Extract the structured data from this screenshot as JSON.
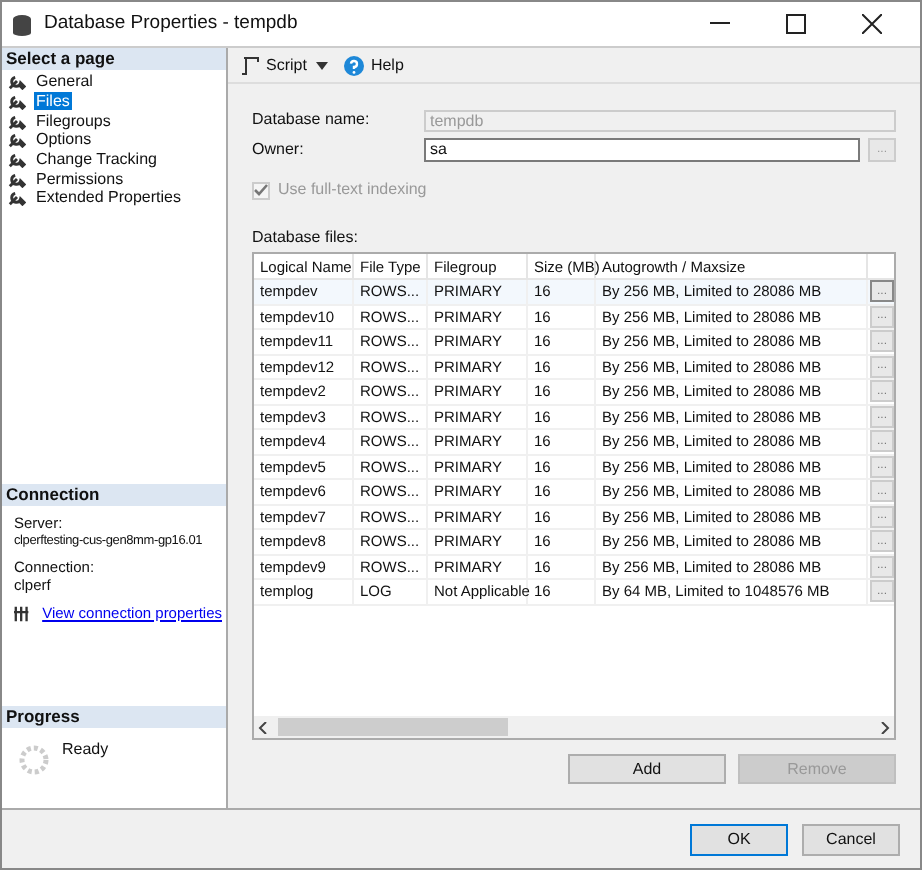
{
  "window": {
    "title": "Database Properties - tempdb"
  },
  "sidebar": {
    "header": "Select a page",
    "pages": [
      {
        "label": "General",
        "selected": false
      },
      {
        "label": "Files",
        "selected": true
      },
      {
        "label": "Filegroups",
        "selected": false
      },
      {
        "label": "Options",
        "selected": false
      },
      {
        "label": "Change Tracking",
        "selected": false
      },
      {
        "label": "Permissions",
        "selected": false
      },
      {
        "label": "Extended Properties",
        "selected": false
      }
    ]
  },
  "connection": {
    "header": "Connection",
    "server_label": "Server:",
    "server": "clperftesting-cus-gen8mm-gp16.01",
    "connection_label": "Connection:",
    "connection": "clperf",
    "link": "View connection properties"
  },
  "progress": {
    "header": "Progress",
    "status": "Ready"
  },
  "toolbar": {
    "script": "Script",
    "help": "Help"
  },
  "form": {
    "database_name": {
      "label": "Database name:",
      "value": "tempdb",
      "disabled": true
    },
    "owner": {
      "label": "Owner:",
      "value": "sa",
      "browse": "..."
    },
    "fulltext": {
      "label": "Use full-text indexing",
      "checked": true,
      "disabled": true
    },
    "files_label": "Database files:"
  },
  "table": {
    "columns": [
      "Logical Name",
      "File Type",
      "Filegroup",
      "Size (MB)",
      "Autogrowth / Maxsize"
    ],
    "rows": [
      {
        "cells": [
          "tempdev",
          "ROWS...",
          "PRIMARY",
          "16",
          "By 256 MB, Limited to 28086 MB"
        ],
        "browse": "...",
        "selected": true
      },
      {
        "cells": [
          "tempdev10",
          "ROWS...",
          "PRIMARY",
          "16",
          "By 256 MB, Limited to 28086 MB"
        ],
        "browse": "...",
        "selected": false
      },
      {
        "cells": [
          "tempdev11",
          "ROWS...",
          "PRIMARY",
          "16",
          "By 256 MB, Limited to 28086 MB"
        ],
        "browse": "...",
        "selected": false
      },
      {
        "cells": [
          "tempdev12",
          "ROWS...",
          "PRIMARY",
          "16",
          "By 256 MB, Limited to 28086 MB"
        ],
        "browse": "...",
        "selected": false
      },
      {
        "cells": [
          "tempdev2",
          "ROWS...",
          "PRIMARY",
          "16",
          "By 256 MB, Limited to 28086 MB"
        ],
        "browse": "...",
        "selected": false
      },
      {
        "cells": [
          "tempdev3",
          "ROWS...",
          "PRIMARY",
          "16",
          "By 256 MB, Limited to 28086 MB"
        ],
        "browse": "...",
        "selected": false
      },
      {
        "cells": [
          "tempdev4",
          "ROWS...",
          "PRIMARY",
          "16",
          "By 256 MB, Limited to 28086 MB"
        ],
        "browse": "...",
        "selected": false
      },
      {
        "cells": [
          "tempdev5",
          "ROWS...",
          "PRIMARY",
          "16",
          "By 256 MB, Limited to 28086 MB"
        ],
        "browse": "...",
        "selected": false
      },
      {
        "cells": [
          "tempdev6",
          "ROWS...",
          "PRIMARY",
          "16",
          "By 256 MB, Limited to 28086 MB"
        ],
        "browse": "...",
        "selected": false
      },
      {
        "cells": [
          "tempdev7",
          "ROWS...",
          "PRIMARY",
          "16",
          "By 256 MB, Limited to 28086 MB"
        ],
        "browse": "...",
        "selected": false
      },
      {
        "cells": [
          "tempdev8",
          "ROWS...",
          "PRIMARY",
          "16",
          "By 256 MB, Limited to 28086 MB"
        ],
        "browse": "...",
        "selected": false
      },
      {
        "cells": [
          "tempdev9",
          "ROWS...",
          "PRIMARY",
          "16",
          "By 256 MB, Limited to 28086 MB"
        ],
        "browse": "...",
        "selected": false
      },
      {
        "cells": [
          "templog",
          "LOG",
          "Not Applicable",
          "16",
          "By 64 MB, Limited to 1048576 MB"
        ],
        "browse": "...",
        "selected": false
      }
    ]
  },
  "table_buttons": [
    {
      "label": "Add",
      "disabled": false
    },
    {
      "label": "Remove",
      "disabled": true
    }
  ],
  "dialog_buttons": [
    {
      "label": "OK",
      "default": true
    },
    {
      "label": "Cancel",
      "default": false
    }
  ]
}
